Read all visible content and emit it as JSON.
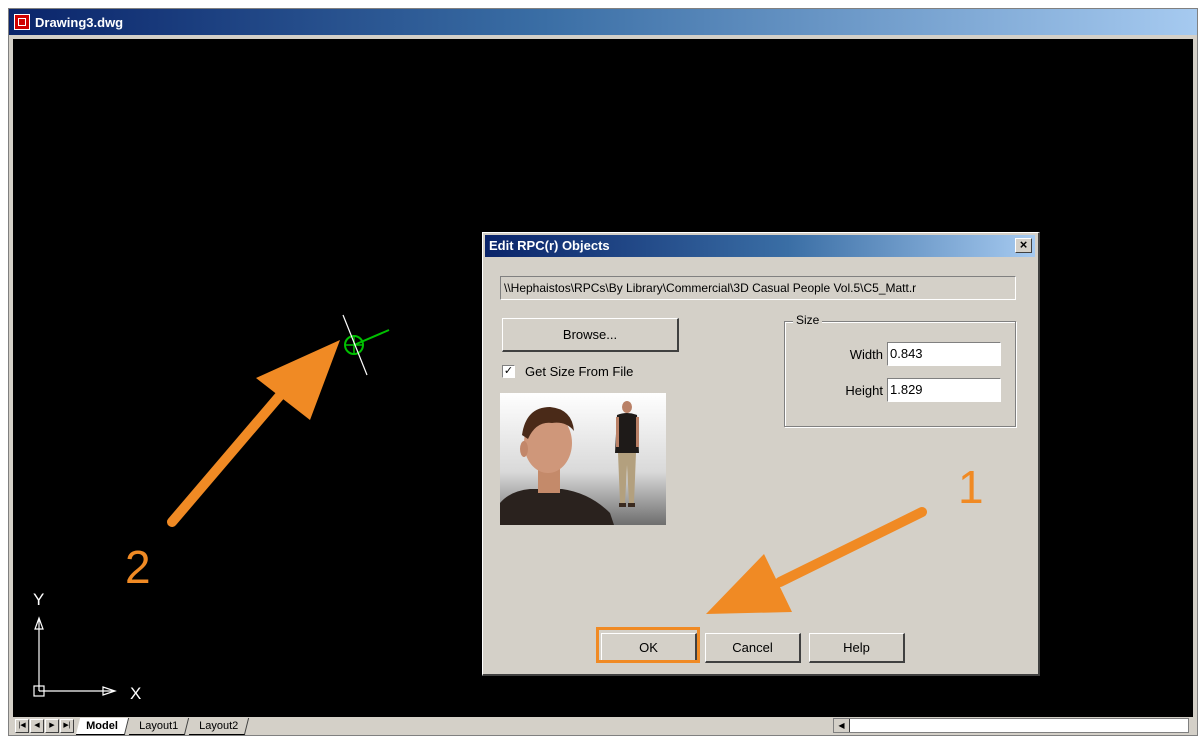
{
  "window": {
    "title": "Drawing3.dwg"
  },
  "tabs": {
    "items": [
      "Model",
      "Layout1",
      "Layout2"
    ],
    "active": "Model"
  },
  "ucs": {
    "x_label": "X",
    "y_label": "Y"
  },
  "dialog": {
    "title": "Edit RPC(r) Objects",
    "close_glyph": "×",
    "path": "\\\\Hephaistos\\RPCs\\By Library\\Commercial\\3D Casual People Vol.5\\C5_Matt.r",
    "browse_label": "Browse...",
    "checkbox_label": "Get Size From File",
    "checkbox_checked": true,
    "checkbox_glyph": "✓",
    "size_group_label": "Size",
    "width_label": "Width",
    "width_value": "0.843",
    "height_label": "Height",
    "height_value": "1.829",
    "ok_label": "OK",
    "cancel_label": "Cancel",
    "help_label": "Help"
  },
  "callouts": {
    "one": "1",
    "two": "2",
    "color": "#f08a24"
  },
  "colors": {
    "canvas": "#000000",
    "marker": "#00c000",
    "titlebar_start": "#0a246a"
  }
}
